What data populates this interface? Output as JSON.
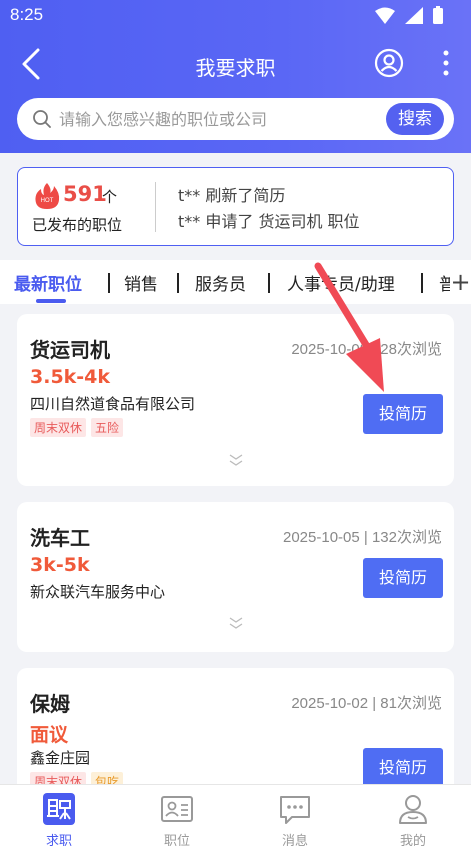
{
  "status_bar": {
    "time": "8:25"
  },
  "nav": {
    "title": "我要求职"
  },
  "search": {
    "placeholder": "请输入您感兴趣的职位或公司",
    "button": "搜索"
  },
  "stats": {
    "hot_badge": "HOT",
    "count": "591",
    "unit": "个",
    "label": "已发布的职位",
    "activities": [
      "t** 刷新了简历",
      "t** 申请了 货运司机 职位"
    ]
  },
  "tabs": [
    {
      "label": "最新职位",
      "active": true
    },
    {
      "label": "销售",
      "active": false
    },
    {
      "label": "服务员",
      "active": false
    },
    {
      "label": "人事专员/助理",
      "active": false
    },
    {
      "label": "普",
      "active": false
    }
  ],
  "jobs": [
    {
      "title": "货运司机",
      "date_views": "2025-10-08 | 28次浏览",
      "salary": "3.5k-4k",
      "company": "四川自然道食品有限公司",
      "tags": [
        {
          "text": "周末双休",
          "color": "red"
        },
        {
          "text": "五险",
          "color": "red"
        }
      ],
      "apply": "投简历"
    },
    {
      "title": "洗车工",
      "date_views": "2025-10-05 | 132次浏览",
      "salary": "3k-5k",
      "company": "新众联汽车服务中心",
      "tags": [],
      "apply": "投简历"
    },
    {
      "title": "保姆",
      "date_views": "2025-10-02 | 81次浏览",
      "salary": "面议",
      "company": "鑫金庄园",
      "tags": [
        {
          "text": "周末双休",
          "color": "red"
        },
        {
          "text": "包吃",
          "color": "orange"
        }
      ],
      "apply": "投简历"
    }
  ],
  "bottom_nav": [
    {
      "label": "求职",
      "icon": "job-seek-icon",
      "active": true
    },
    {
      "label": "职位",
      "icon": "position-card-icon",
      "active": false
    },
    {
      "label": "消息",
      "icon": "message-icon",
      "active": false
    },
    {
      "label": "我的",
      "icon": "profile-icon",
      "active": false
    }
  ],
  "colors": {
    "primary": "#4f5ff2",
    "accent_red": "#e94e47",
    "salary": "#f05a3a",
    "annotation_arrow": "#f04a55"
  }
}
